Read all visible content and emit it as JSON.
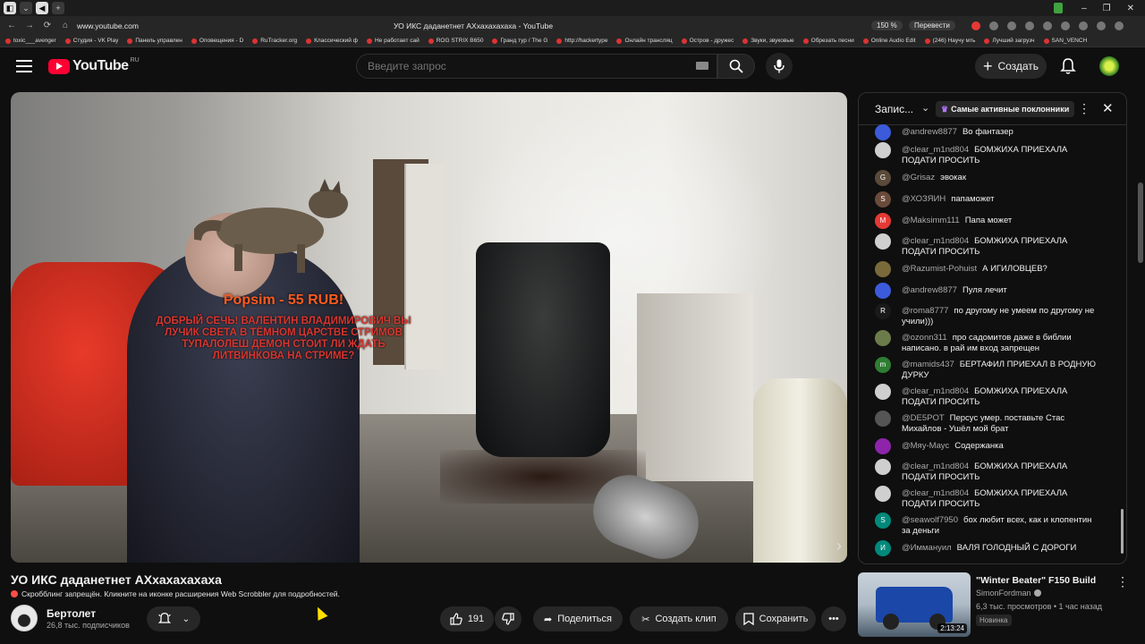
{
  "browser": {
    "url": "www.youtube.com",
    "tab_title": "УО ИКС даданетнет АХхахахахаха - YouTube",
    "zoom": "150 %",
    "translate_label": "Перевести"
  },
  "bookmarks": [
    "toxic___avenger",
    "Студия - VK Play",
    "Панель управлен",
    "Оповещения - D",
    "RuTracker.org",
    "Классический ф",
    "Не работает сай",
    "ROG STRIX B650",
    "Гранд тур / The G",
    "http://hackertype",
    "Онлайн трансляц",
    "Остров - дружес",
    "Звуки, звуковые",
    "Обрезать песни",
    "Online Audio Edit",
    "(246) Научу мть",
    "Лучший загрузч",
    "SAN_VENCH"
  ],
  "header": {
    "logo_text": "YouTube",
    "logo_region": "RU",
    "search_placeholder": "Введите запрос",
    "create_label": "Создать"
  },
  "video": {
    "overlay_amount": "Popsim - 55 RUB!",
    "overlay_message": "ДОБРЫЙ СЕЧЬ! ВАЛЕНТИН ВЛАДИМИРОВИЧ ВЫ ЛУЧИК СВЕТА В ТЁМНОМ ЦАРСТВЕ СТРИМОВ ТУПАЛОЛЕШ ДЕМОН СТОИТ ЛИ ЖДАТЬ ЛИТВИНКОВА НА СТРИМЕ?",
    "title": "УО ИКС даданетнет АХхахахахаха",
    "scrobble_notice": "Скробблинг запрещён. Кликните на иконке расширения Web Scrobbler для подробностей.",
    "channel_name": "Бертолет",
    "channel_subs": "26,8 тыс. подписчиков",
    "like_count": "191",
    "share_label": "Поделиться",
    "clip_label": "Создать клип",
    "save_label": "Сохранить"
  },
  "chat": {
    "mode_label": "Запис...",
    "fans_label": "Самые активные поклонники",
    "messages": [
      {
        "author": "@andrew8877",
        "text": "Во фантазер",
        "avatar": "",
        "color": "#3b5bdb"
      },
      {
        "author": "@clear_m1nd804",
        "text": "БОМЖИХА ПРИЕХАЛА ПОДАТИ ПРОСИТЬ",
        "avatar": "",
        "color": "#cfcfcf"
      },
      {
        "author": "@Grisaz",
        "text": "эвокак",
        "avatar": "G",
        "color": "#5a4a3a"
      },
      {
        "author": "@ХОЗЯИН",
        "text": "папаможет",
        "avatar": "S",
        "color": "#6a4a3a"
      },
      {
        "author": "@Maksimm111",
        "text": "Папа может",
        "avatar": "M",
        "color": "#e53935"
      },
      {
        "author": "@clear_m1nd804",
        "text": "БОМЖИХА ПРИЕХАЛА ПОДАТИ ПРОСИТЬ",
        "avatar": "",
        "color": "#cfcfcf"
      },
      {
        "author": "@Razumist-Pohuist",
        "text": "А ИГИЛОВЦЕВ?",
        "avatar": "",
        "color": "#7a6a3a"
      },
      {
        "author": "@andrew8877",
        "text": "Пуля лечит",
        "avatar": "",
        "color": "#3b5bdb"
      },
      {
        "author": "@roma8777",
        "text": "по другому не умеем по другому не учили)))",
        "avatar": "R",
        "color": "#1a1a1a"
      },
      {
        "author": "@ozonn311",
        "text": "про садомитов даже в библии написано. в рай им вход запрещен",
        "avatar": "",
        "color": "#6b7b4a"
      },
      {
        "author": "@mamids437",
        "text": "БЕРТАФИЛ ПРИЕХАЛ В РОДНУЮ ДУРКУ",
        "avatar": "m",
        "color": "#2e7d32"
      },
      {
        "author": "@clear_m1nd804",
        "text": "БОМЖИХА ПРИЕХАЛА ПОДАТИ ПРОСИТЬ",
        "avatar": "",
        "color": "#cfcfcf"
      },
      {
        "author": "@DE5POT",
        "text": "Персус умер. поставьте Стас Михайлов - Ушёл мой брат",
        "avatar": "",
        "color": "#555555"
      },
      {
        "author": "@Мяу-Маус",
        "text": "Содержанка",
        "avatar": "",
        "color": "#8e24aa"
      },
      {
        "author": "@clear_m1nd804",
        "text": "БОМЖИХА ПРИЕХАЛА ПОДАТИ ПРОСИТЬ",
        "avatar": "",
        "color": "#cfcfcf"
      },
      {
        "author": "@clear_m1nd804",
        "text": "БОМЖИХА ПРИЕХАЛА ПОДАТИ ПРОСИТЬ",
        "avatar": "",
        "color": "#cfcfcf"
      },
      {
        "author": "@seawolf7950",
        "text": "бох любит всех, как и клопентин за деньги",
        "avatar": "S",
        "color": "#00897b"
      },
      {
        "author": "@Иммануил",
        "text": "ВАЛЯ ГОЛОДНЫЙ С ДОРОГИ",
        "avatar": "И",
        "color": "#00897b"
      }
    ]
  },
  "recommendation": {
    "title": "\"Winter Beater\" F150 Build",
    "channel": "SimonFordman",
    "meta": "6,3 тыс. просмотров • 1 час назад",
    "badge": "Новинка",
    "duration": "2:13:24"
  }
}
